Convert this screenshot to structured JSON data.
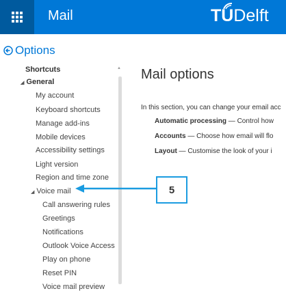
{
  "topbar": {
    "app_title": "Mail",
    "brand_t": "T",
    "brand_u": "U",
    "brand_rest": "Delft",
    "bg_color": "#0078d7"
  },
  "options": {
    "title": "Options"
  },
  "nav": {
    "shortcuts": "Shortcuts",
    "general": "General",
    "general_items": [
      "My account",
      "Keyboard shortcuts",
      "Manage add-ins",
      "Mobile devices",
      "Accessibility settings",
      "Light version",
      "Region and time zone"
    ],
    "voice_mail": "Voice mail",
    "voice_mail_items": [
      "Call answering rules",
      "Greetings",
      "Notifications",
      "Outlook Voice Access",
      "Play on phone",
      "Reset PIN",
      "Voice mail preview"
    ]
  },
  "main": {
    "title": "Mail options",
    "intro": "In this section, you can change your email acc",
    "bullets": [
      {
        "term": "Automatic processing",
        "text": " — Control how"
      },
      {
        "term": "Accounts",
        "text": " — Choose how email will flo"
      },
      {
        "term": "Layout",
        "text": " — Customise the look of your i"
      }
    ]
  },
  "callout": {
    "number": "5",
    "color": "#1a9be0"
  }
}
